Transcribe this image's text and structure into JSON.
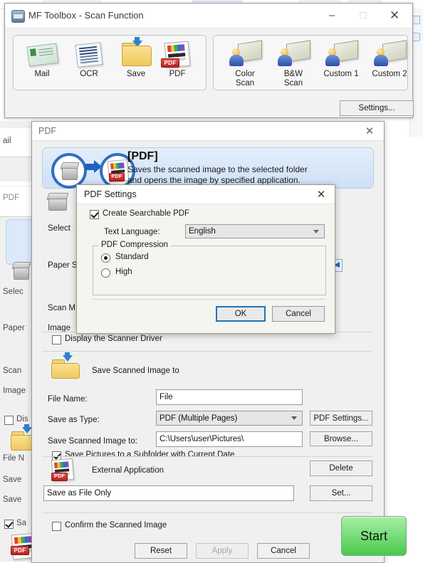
{
  "toolbox": {
    "title": "MF Toolbox - Scan Function",
    "app_icon": "scanner-app-icon",
    "window_buttons": {
      "minimize": "–",
      "maximize": "□",
      "close": "✕"
    },
    "functions_primary": [
      {
        "label": "Mail",
        "icon": "mail-icon"
      },
      {
        "label": "OCR",
        "icon": "ocr-document-icon"
      },
      {
        "label": "Save",
        "icon": "save-folder-icon"
      },
      {
        "label": "PDF",
        "icon": "pdf-document-icon"
      }
    ],
    "functions_secondary": [
      {
        "label": "Color\nScan",
        "line1": "Color",
        "line2": "Scan",
        "icon": "user-scan-icon"
      },
      {
        "label": "B&W\nScan",
        "line1": "B&W",
        "line2": "Scan",
        "icon": "user-scan-icon"
      },
      {
        "label": "Custom 1",
        "line1": "Custom 1",
        "line2": "",
        "icon": "user-scan-icon"
      },
      {
        "label": "Custom 2",
        "line1": "Custom 2",
        "line2": "",
        "icon": "user-scan-icon"
      }
    ],
    "settings_button": "Settings..."
  },
  "pdf_dialog": {
    "title": "PDF",
    "close": "✕",
    "banner": {
      "title": "[PDF]",
      "description_line1": "Saves the scanned image to the selected folder",
      "description_line2": "and opens the image by specified application.",
      "from_icon": "scanner-icon",
      "to_icon": "pdf-document-icon",
      "arrow_icon": "arrow-right-icon"
    },
    "rows": {
      "select_scanner_label": "Select",
      "paper_size_label": "Paper S",
      "scan_mode_label": "Scan M",
      "image_quality_label": "Image"
    },
    "display_driver_checkbox": {
      "label": "Display the Scanner Driver",
      "checked": false
    },
    "save_section": {
      "heading": "Save Scanned Image to",
      "icon": "save-folder-icon",
      "file_name_label": "File Name:",
      "file_name_value": "File",
      "save_as_type_label": "Save as Type:",
      "save_as_type_value": "PDF (Multiple Pages)",
      "pdf_settings_button": "PDF Settings...",
      "save_to_label": "Save Scanned Image to:",
      "save_to_value": "C:\\Users\\user\\Pictures\\",
      "browse_button": "Browse...",
      "subfolder_checkbox": {
        "label": "Save Pictures to a Subfolder with Current Date",
        "checked": true
      }
    },
    "external_app": {
      "heading": "External Application",
      "icon": "pdf-document-icon",
      "value": "Save as File Only",
      "delete_button": "Delete",
      "set_button": "Set..."
    },
    "confirm_checkbox": {
      "label": "Confirm the Scanned Image",
      "checked": false
    },
    "footer": {
      "reset_button": "Reset",
      "apply_button": "Apply",
      "apply_disabled": true,
      "cancel_button": "Cancel",
      "start_button": "Start"
    }
  },
  "pdf_settings_dialog": {
    "title": "PDF Settings",
    "close": "✕",
    "searchable_checkbox": {
      "label": "Create Searchable PDF",
      "checked": true
    },
    "text_language_label": "Text Language:",
    "text_language_value": "English",
    "compression_group_label": "PDF Compression",
    "compression_options": [
      {
        "label": "Standard",
        "selected": true
      },
      {
        "label": "High",
        "selected": false
      }
    ],
    "ok_button": "OK",
    "cancel_button": "Cancel"
  },
  "background_window": {
    "labels": [
      "ail",
      "PDF",
      "Selec",
      "Paper",
      "Scan",
      "Image",
      "Dis",
      "File N",
      "Save",
      "Save",
      "Sa"
    ]
  },
  "colors": {
    "accent_blue": "#2f6fc4",
    "focus_blue": "#1e74b8",
    "start_green": "#49c94f",
    "banner_bg": "#dbe9fb",
    "window_bg": "#f0f0f0",
    "pdf_red": "#b92121"
  }
}
